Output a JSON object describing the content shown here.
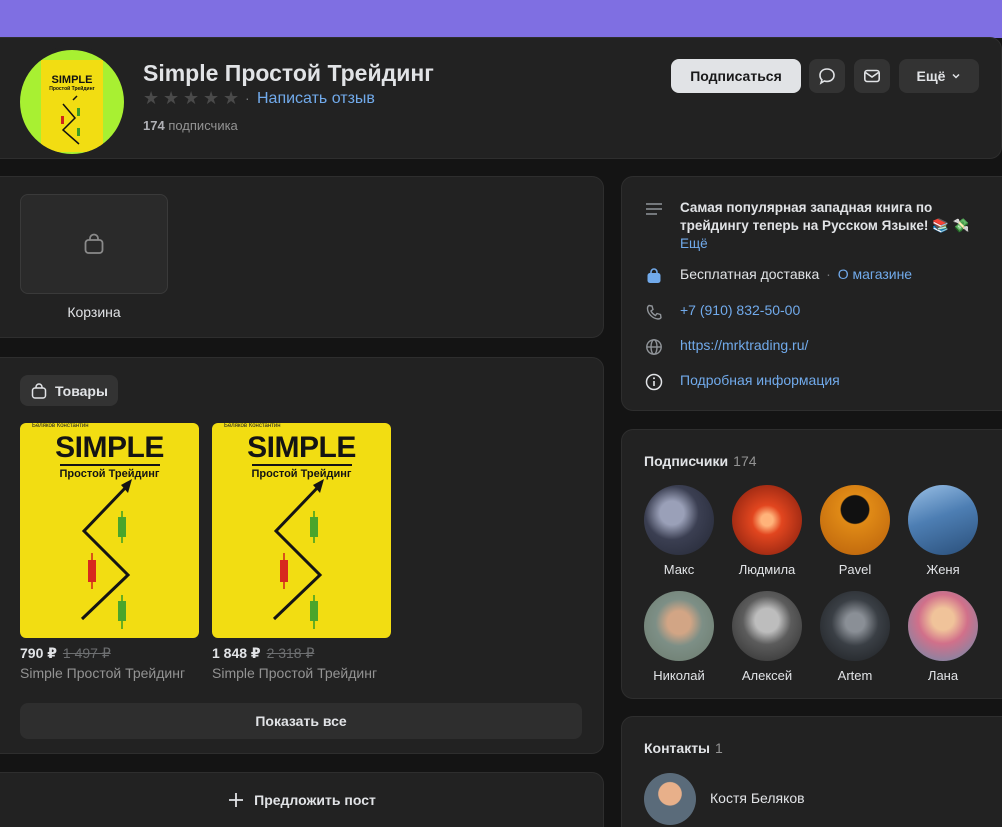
{
  "header": {
    "avatar_book_title": "SIMPLE",
    "avatar_book_subtitle": "Простой Трейдинг",
    "name": "Simple Простой Трейдинг",
    "rating_separator": "·",
    "review_link": "Написать отзыв",
    "subscriber_count": "174",
    "subscriber_word": "подписчика",
    "subscribe_button": "Подписаться",
    "more_button": "Ещё"
  },
  "cart": {
    "label": "Корзина"
  },
  "goods": {
    "title": "Товары",
    "products": [
      {
        "author": "Беляков Константин",
        "cover_title": "SIMPLE",
        "cover_subtitle": "Простой Трейдинг",
        "price": "790 ₽",
        "old_price": "1 497 ₽",
        "title": "Simple Простой Трейдинг"
      },
      {
        "author": "Беляков Константин",
        "cover_title": "SIMPLE",
        "cover_subtitle": "Простой Трейдинг",
        "price": "1 848 ₽",
        "old_price": "2 318 ₽",
        "title": "Simple Простой Трейдинг"
      }
    ],
    "show_all": "Показать все"
  },
  "suggest": {
    "label": "Предложить пост"
  },
  "info": {
    "description": "Самая популярная западная книга по трейдингу теперь на Русском Языке! 📚 💸",
    "description_more": "Ещё",
    "delivery": "Бесплатная доставка",
    "delivery_sep": "·",
    "about_shop": "О магазине",
    "phone": "+7 (910) 832-50-00",
    "website": "https://mrktrading.ru/",
    "details": "Подробная информация"
  },
  "subscribers": {
    "title": "Подписчики",
    "count": "174",
    "people": [
      {
        "name": "Макс",
        "color": "#4a4f63"
      },
      {
        "name": "Людмила",
        "color": "#d2401f"
      },
      {
        "name": "Pavel",
        "color": "#e08a16"
      },
      {
        "name": "Женя",
        "color": "#5b86b8"
      },
      {
        "name": "Николай",
        "color": "#a48a6c"
      },
      {
        "name": "Алексей",
        "color": "#6a6a6a"
      },
      {
        "name": "Artem",
        "color": "#3a3f45"
      },
      {
        "name": "Лана",
        "color": "#d1708a"
      }
    ]
  },
  "contacts": {
    "title": "Контакты",
    "count": "1",
    "name": "Костя Беляков"
  }
}
